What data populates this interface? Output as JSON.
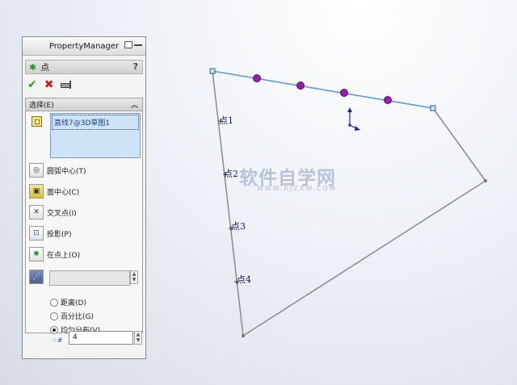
{
  "panel": {
    "title": "PropertyManager",
    "feature_name": "点",
    "help": "?",
    "selection_group_label": "选择(E)",
    "selected_items": [
      "直线7@3D草图1"
    ],
    "options": [
      {
        "label": "圆弧中心(T)",
        "icon": "arc-center-icon"
      },
      {
        "label": "面中心(C)",
        "icon": "face-center-icon"
      },
      {
        "label": "交叉点(I)",
        "icon": "intersection-icon"
      },
      {
        "label": "投影(P)",
        "icon": "projection-icon"
      },
      {
        "label": "在点上(O)",
        "icon": "on-point-icon"
      }
    ],
    "distribution_label_icon": "along-curve-icon",
    "distribution_value": "",
    "radio": [
      {
        "label": "距离(D)",
        "checked": false
      },
      {
        "label": "百分比(G)",
        "checked": false
      },
      {
        "label": "均匀分布(V)",
        "checked": true
      }
    ],
    "count_value": "4"
  },
  "viewport": {
    "point_labels": [
      "点1",
      "点2",
      "点3",
      "点4"
    ],
    "watermark": "软件自学网",
    "watermark_url": "WWW.RJZXW.COM",
    "colors": {
      "selected_line": "#5a9ad8",
      "points": "#9a1ea8",
      "edges": "#8a8a8a"
    }
  }
}
